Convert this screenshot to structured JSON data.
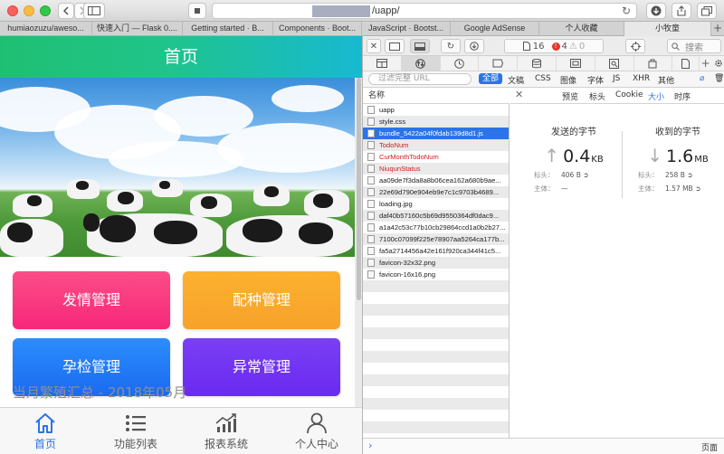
{
  "browser": {
    "url": "/uapp/",
    "tabs": [
      "humiaozuzu/aweso...",
      "快速入门 — Flask 0....",
      "Getting started · B...",
      "Components · Boot...",
      "JavaScript · Bootst...",
      "Google AdSense",
      "个人收藏",
      "小牧童"
    ],
    "active_tab": 7
  },
  "app": {
    "header_title": "首页",
    "cards": [
      "发情管理",
      "配种管理",
      "孕检管理",
      "异常管理"
    ],
    "summary_title": "当月繁殖汇总 - 2018年05月",
    "tabbar": [
      {
        "label": "首页",
        "icon": "home-icon"
      },
      {
        "label": "功能列表",
        "icon": "list-icon"
      },
      {
        "label": "报表系统",
        "icon": "chart-icon"
      },
      {
        "label": "个人中心",
        "icon": "user-icon"
      }
    ]
  },
  "devtools": {
    "resources_count": "16",
    "errors_count": "4",
    "warnings_count": "0",
    "search_placeholder": "搜索",
    "filter_placeholder": "过滤完整 URL",
    "filter_types": [
      "全部",
      "文稿",
      "CSS",
      "图像",
      "字体",
      "JS",
      "XHR",
      "其他"
    ],
    "list_header": "名称",
    "files": [
      {
        "name": "uapp",
        "state": "normal"
      },
      {
        "name": "style.css",
        "state": "normal"
      },
      {
        "name": "bundle_5422a04f0fdab139d8d1.js",
        "state": "selected"
      },
      {
        "name": "TodoNum",
        "state": "error"
      },
      {
        "name": "CurMonthTodoNum",
        "state": "error"
      },
      {
        "name": "NiuqunStatus",
        "state": "error"
      },
      {
        "name": "aa09de7f3da8a8b06cea162a680b9ae...",
        "state": "normal"
      },
      {
        "name": "22e69d790e904eb9e7c1c9703b4689...",
        "state": "normal"
      },
      {
        "name": "loading.jpg",
        "state": "normal"
      },
      {
        "name": "daf40b57160c5b69d9550364df0dac9...",
        "state": "normal"
      },
      {
        "name": "a1a42c53c77b10cb29864ccd1a0b2b27...",
        "state": "normal"
      },
      {
        "name": "7100c07099f225e78907aa5264ca177b...",
        "state": "normal"
      },
      {
        "name": "fa5a2714456a42e161f920ca344f41c5...",
        "state": "normal"
      },
      {
        "name": "favicon-32x32.png",
        "state": "normal"
      },
      {
        "name": "favicon-16x16.png",
        "state": "normal"
      }
    ],
    "detail_tabs": [
      "预览",
      "标头",
      "Cookie",
      "大小",
      "时序"
    ],
    "active_detail_tab": 3,
    "sent": {
      "title": "发送的字节",
      "value": "0.4",
      "unit": "KB",
      "headers_label": "标头：",
      "headers_value": "406 B",
      "body_label": "主体：",
      "body_value": "—"
    },
    "received": {
      "title": "收到的字节",
      "value": "1.6",
      "unit": "MB",
      "headers_label": "标头：",
      "headers_value": "258 B",
      "body_label": "主体：",
      "body_value": "1.57 MB"
    },
    "console_prompt": "›",
    "page_selector": "页面"
  }
}
